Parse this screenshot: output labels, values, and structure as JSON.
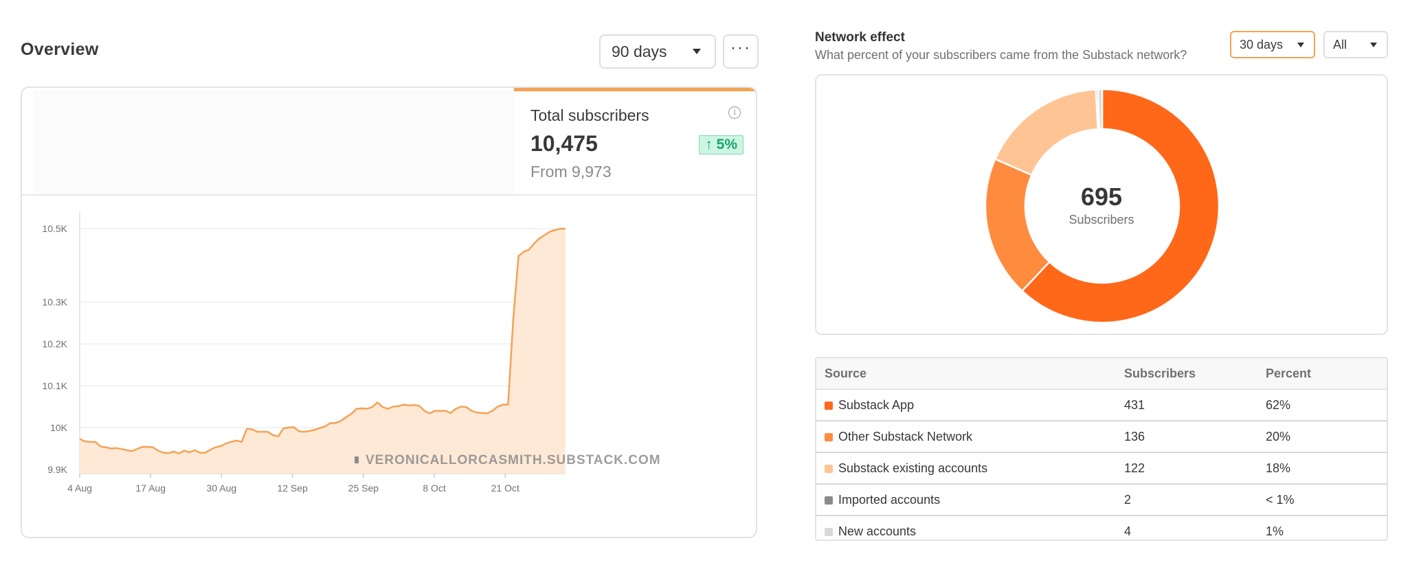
{
  "overview": {
    "title": "Overview",
    "range": "90 days",
    "more": "···",
    "metric": {
      "label": "Total subscribers",
      "value": "10,475",
      "delta": "↑ 5%",
      "from": "From 9,973",
      "accent": "#f4a254"
    },
    "watermark": "VERONICALLORCASMITH.SUBSTACK.COM"
  },
  "chart_data": [
    {
      "type": "area",
      "title": "",
      "xlabel": "",
      "ylabel": "",
      "x_ticks": [
        "4 Aug",
        "17 Aug",
        "30 Aug",
        "12 Sep",
        "25 Sep",
        "8 Oct",
        "21 Oct"
      ],
      "y_ticks": [
        "9.9K",
        "10K",
        "10.1K",
        "10.2K",
        "10.3K",
        "10.5K"
      ],
      "y_tick_values": [
        9900,
        10000,
        10100,
        10200,
        10300,
        10475
      ],
      "ylim": [
        9890,
        10500
      ],
      "grid": true,
      "color": "#f4a254",
      "series": [
        {
          "values": [
            9973,
            9967,
            9966,
            9966,
            9955,
            9953,
            9950,
            9951,
            9949,
            9946,
            9944,
            9949,
            9954,
            9954,
            9953,
            9945,
            9940,
            9939,
            9943,
            9938,
            9945,
            9941,
            9946,
            9940,
            9940,
            9947,
            9953,
            9956,
            9962,
            9966,
            9969,
            9966,
            9997,
            9996,
            9990,
            9990,
            9990,
            9982,
            9979,
            9998,
            10000,
            10001,
            9991,
            9990,
            9992,
            9995,
            9999,
            10003,
            10011,
            10011,
            10016,
            10025,
            10033,
            10045,
            10046,
            10045,
            10049,
            10060,
            10049,
            10045,
            10050,
            10051,
            10055,
            10053,
            10054,
            10052,
            10040,
            10034,
            10040,
            10040,
            10040,
            10035,
            10045,
            10050,
            10049,
            10040,
            10036,
            10035,
            10034,
            10040,
            10050,
            10055,
            10055,
            10260,
            10410,
            10420,
            10425,
            10440,
            10452,
            10460,
            10468,
            10472,
            10475,
            10475
          ]
        }
      ]
    },
    {
      "type": "pie",
      "title": "",
      "labels": [
        "Substack App",
        "Other Substack Network",
        "Substack existing accounts",
        "Imported accounts",
        "New accounts"
      ],
      "values": [
        431,
        136,
        122,
        2,
        4
      ],
      "colors": [
        "#ff6719",
        "#ff8b3f",
        "#ffc494",
        "#8a8a8a",
        "#d8d8d8"
      ],
      "center_value": "695",
      "center_label": "Subscribers"
    }
  ],
  "network": {
    "title": "Network effect",
    "subtitle": "What percent of your subscribers came from the Substack network?",
    "period": "30 days",
    "filter": "All",
    "center_value": "695",
    "center_label": "Subscribers",
    "table": {
      "headers": [
        "Source",
        "Subscribers",
        "Percent"
      ],
      "rows": [
        {
          "source": "Substack App",
          "subscribers": "431",
          "percent": "62%",
          "color": "#ff6719"
        },
        {
          "source": "Other Substack Network",
          "subscribers": "136",
          "percent": "20%",
          "color": "#ff8b3f"
        },
        {
          "source": "Substack existing accounts",
          "subscribers": "122",
          "percent": "18%",
          "color": "#ffc494"
        },
        {
          "source": "Imported accounts",
          "subscribers": "2",
          "percent": "< 1%",
          "color": "#8a8a8a"
        },
        {
          "source": "New accounts",
          "subscribers": "4",
          "percent": "1%",
          "color": "#d8d8d8"
        }
      ]
    }
  }
}
